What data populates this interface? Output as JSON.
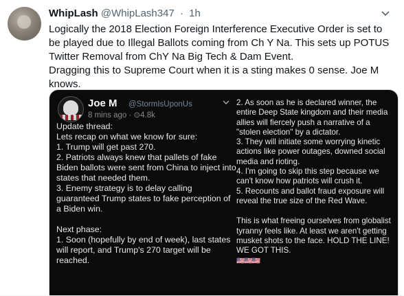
{
  "tweet": {
    "display_name": "WhipLash",
    "handle": "@WhipLash347",
    "separator": "·",
    "time": "1h",
    "text_1": "Logically the 2018 Election Foreign Interference Executive Order is set to be played due to Illegal Ballots coming from Ch Y Na. This sets up POTUS Twitter Removal from ChY Na Big Tech & Dam Event.",
    "text_2": "Dragging this to Supreme Court when it is a sting makes 0 sense. Joe M knows."
  },
  "embedded": {
    "name": "Joe M",
    "handle": "@StormIsUponUs",
    "meta": "8 mins ago · ⊙4.8k",
    "left_lines": [
      "Update thread:",
      "Lets recap on what we know for sure:",
      "1. Trump will get past 270.",
      "2. Patriots always knew that pallets of fake Biden ballots were sent from China to inject into states that needed them.",
      "3. Enemy strategy is to delay calling guaranteed Trump states to fake perception of a Biden win.",
      "",
      "Next phase:",
      "1. Soon (hopefully by end of week), last states will report, and Trump's 270 target will be reached."
    ],
    "right_lines": [
      "2. As soon as he is declared winner, the entire Deep State kingdom and their media allies will fiercely push a narrative of a \"stolen election\" by a dictator.",
      "3. They will initiate some worrying kinetic actions like power outages, downed social media and rioting.",
      "4. I'm going to skip this step because we can't know how patriots will crush it.",
      "5. Recounts and ballot fraud exposure will reveal the true size of the Red Wave.",
      "",
      "This is what freeing ourselves from globalist tyranny feels like. At least we aren't getting musket shots to the face. HOLD THE LINE! WE GOT THIS."
    ],
    "flags": "🇺🇸🇺🇸🇺🇸"
  },
  "icons": {
    "caret": "chevron-down-icon",
    "inner_chevron": "chevron-down-icon"
  },
  "colors": {
    "name": "#0f1419",
    "secondary": "#536471",
    "media_bg": "#0b0b0b"
  }
}
